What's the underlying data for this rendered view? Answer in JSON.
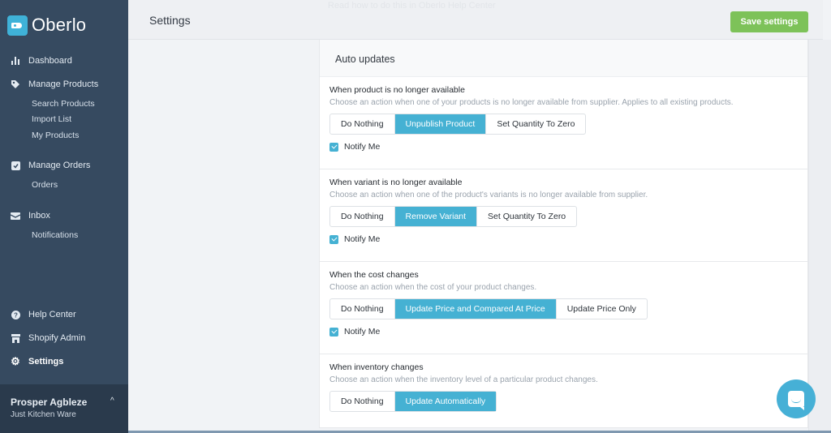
{
  "app": {
    "name": "Oberlo",
    "brand_color": "#3fb2d8",
    "sidebar_color": "#364a60"
  },
  "sidebar": {
    "items": [
      {
        "label": "Dashboard",
        "icon": "bar-chart-icon"
      },
      {
        "label": "Manage Products",
        "icon": "tag-icon",
        "children": [
          "Search Products",
          "Import List",
          "My Products"
        ]
      },
      {
        "label": "Manage Orders",
        "icon": "checkbox-icon",
        "children": [
          "Orders"
        ]
      },
      {
        "label": "Inbox",
        "icon": "inbox-icon",
        "children": [
          "Notifications"
        ]
      }
    ],
    "bottom_items": [
      {
        "label": "Help Center",
        "icon": "question-icon"
      },
      {
        "label": "Shopify Admin",
        "icon": "store-icon"
      },
      {
        "label": "Settings",
        "icon": "gear-icon",
        "active": true
      }
    ],
    "user": {
      "name": "Prosper Agbleze",
      "store": "Just Kitchen Ware"
    }
  },
  "header": {
    "title": "Settings",
    "ghost_text": "Read how to do this in Oberlo Help Center",
    "save_label": "Save settings",
    "save_color": "#7dc259"
  },
  "card": {
    "title": "Auto updates",
    "accent_color": "#45b1d3",
    "sections": [
      {
        "title": "When product is no longer available",
        "description": "Choose an action when one of your products is no longer available from supplier. Applies to all existing products.",
        "options": [
          "Do Nothing",
          "Unpublish Product",
          "Set Quantity To Zero"
        ],
        "selected": "Unpublish Product",
        "notify_label": "Notify Me",
        "notify_checked": true
      },
      {
        "title": "When variant is no longer available",
        "description": "Choose an action when one of the product's variants is no longer available from supplier.",
        "options": [
          "Do Nothing",
          "Remove Variant",
          "Set Quantity To Zero"
        ],
        "selected": "Remove Variant",
        "notify_label": "Notify Me",
        "notify_checked": true
      },
      {
        "title": "When the cost changes",
        "description": "Choose an action when the cost of your product changes.",
        "options": [
          "Do Nothing",
          "Update Price and Compared At Price",
          "Update Price Only"
        ],
        "selected": "Update Price and Compared At Price",
        "notify_label": "Notify Me",
        "notify_checked": true
      },
      {
        "title": "When inventory changes",
        "description": "Choose an action when the inventory level of a particular product changes.",
        "options": [
          "Do Nothing",
          "Update Automatically"
        ],
        "selected": "Update Automatically"
      }
    ]
  },
  "chat": {
    "icon": "chat-bubble-icon"
  }
}
